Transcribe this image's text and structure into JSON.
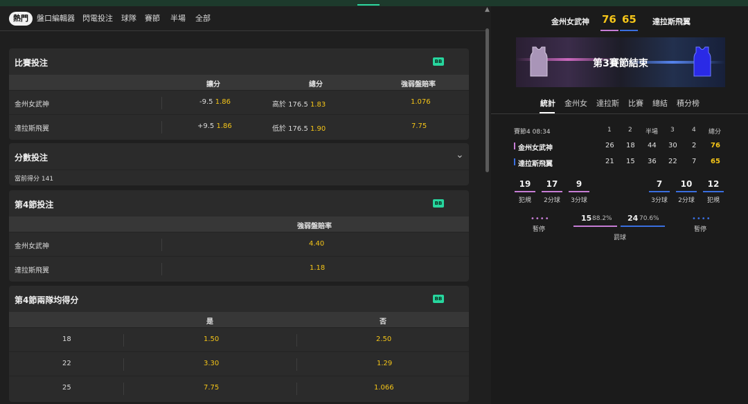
{
  "colors": {
    "accent": "#f5c518",
    "brand_green": "#27d69e",
    "home_color": "#c77dd6",
    "away_color": "#3a6fe0"
  },
  "tabs": [
    "熱門",
    "盤口編輯器",
    "閃電投注",
    "球隊",
    "賽節",
    "半場",
    "全部"
  ],
  "badge": "BB",
  "match_bet": {
    "title": "比賽投注",
    "headers": [
      "讓分",
      "總分",
      "強弱盤賠率"
    ],
    "rows": [
      {
        "team": "金州女武神",
        "hcp": "-9.5",
        "hcp_odds": "1.86",
        "total": "高於 176.5",
        "total_odds": "1.83",
        "ml": "1.076"
      },
      {
        "team": "達拉斯飛翼",
        "hcp": "+9.5",
        "hcp_odds": "1.86",
        "total": "低於 176.5",
        "total_odds": "1.90",
        "ml": "7.75"
      }
    ]
  },
  "score_bet": {
    "title": "分數投注",
    "current": "當前得分 141"
  },
  "q4_bet": {
    "title": "第4節投注",
    "header": "強弱盤賠率",
    "rows": [
      {
        "team": "金州女武神",
        "odds": "4.40"
      },
      {
        "team": "達拉斯飛翼",
        "odds": "1.18"
      }
    ]
  },
  "q4_both": {
    "title": "第4節兩隊均得分",
    "headers": [
      "是",
      "否"
    ],
    "rows": [
      {
        "line": "18",
        "yes": "1.50",
        "no": "2.50"
      },
      {
        "line": "22",
        "yes": "3.30",
        "no": "1.29"
      },
      {
        "line": "25",
        "yes": "7.75",
        "no": "1.066"
      }
    ]
  },
  "scoreboard": {
    "home": "金州女武神",
    "away": "達拉斯飛翼",
    "home_score": "76",
    "away_score": "65",
    "status": "第3賽節結束",
    "stat_tabs": [
      "統計",
      "金州女",
      "達拉斯",
      "比賽",
      "總結",
      "積分榜"
    ],
    "period": "賽節4",
    "clock": "08:34",
    "cols": [
      "1",
      "2",
      "半場",
      "3",
      "4",
      "總分"
    ],
    "home_q": [
      "26",
      "18",
      "44",
      "30",
      "2",
      "76"
    ],
    "away_q": [
      "21",
      "15",
      "36",
      "22",
      "7",
      "65"
    ],
    "home_stats": [
      {
        "v": "19",
        "l": "犯規"
      },
      {
        "v": "17",
        "l": "2分球"
      },
      {
        "v": "9",
        "l": "3分球"
      }
    ],
    "away_stats": [
      {
        "v": "7",
        "l": "3分球"
      },
      {
        "v": "10",
        "l": "2分球"
      },
      {
        "v": "12",
        "l": "犯規"
      }
    ],
    "timeout_label": "暫停",
    "ft_home": "15",
    "ft_home_pct": "88.2%",
    "ft_away": "24",
    "ft_away_pct": "70.6%",
    "ft_label": "罰球"
  }
}
